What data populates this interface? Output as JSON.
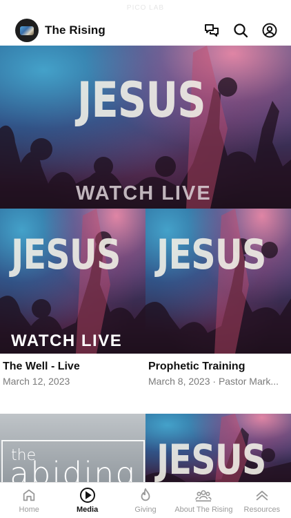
{
  "status_bar": {
    "text": "PICO LAB"
  },
  "header": {
    "title": "The Rising"
  },
  "hero": {
    "art_word": "JESUS",
    "overlay": "WATCH  LIVE"
  },
  "cards": [
    {
      "art_word": "JESUS",
      "overlay": "WATCH  LIVE",
      "title": "The Well - Live",
      "subtitle": "March 12, 2023"
    },
    {
      "art_word": "JESUS",
      "overlay": "",
      "title": "Prophetic Training",
      "subtitle": "March 8, 2023 · Pastor Mark..."
    }
  ],
  "row2": [
    {
      "art_the": "the",
      "art_word": "abiding"
    },
    {
      "art_word": "JESUS"
    }
  ],
  "tabs": [
    {
      "label": "Home",
      "icon": "home-icon",
      "active": false
    },
    {
      "label": "Media",
      "icon": "play-circle-icon",
      "active": true
    },
    {
      "label": "Giving",
      "icon": "flame-icon",
      "active": false
    },
    {
      "label": "About The Rising",
      "icon": "people-icon",
      "active": false
    },
    {
      "label": "Resources",
      "icon": "chevrons-up-icon",
      "active": false
    }
  ],
  "colors": {
    "active_tab": "#111111",
    "inactive_tab": "#9a9a9a",
    "subtitle": "#7a7a7a"
  }
}
